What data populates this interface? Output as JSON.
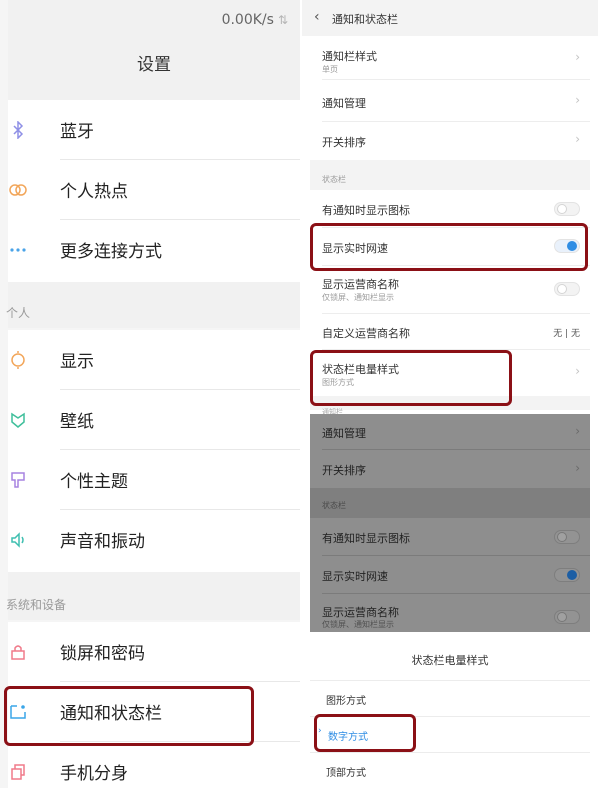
{
  "left": {
    "status_speed": "0.00K/s",
    "title": "设置",
    "connect_items": [
      {
        "label": "蓝牙",
        "icon": "bluetooth-icon"
      },
      {
        "label": "个人热点",
        "icon": "hotspot-icon"
      },
      {
        "label": "更多连接方式",
        "icon": "more-icon"
      }
    ],
    "section_personal": "个人",
    "personal_items": [
      {
        "label": "显示",
        "icon": "display-icon"
      },
      {
        "label": "壁纸",
        "icon": "wallpaper-icon"
      },
      {
        "label": "个性主题",
        "icon": "theme-icon"
      },
      {
        "label": "声音和振动",
        "icon": "sound-icon"
      }
    ],
    "section_system": "系统和设备",
    "system_items": [
      {
        "label": "锁屏和密码",
        "icon": "lock-icon"
      },
      {
        "label": "通知和状态栏",
        "icon": "notification-icon"
      },
      {
        "label": "手机分身",
        "icon": "clone-icon"
      }
    ]
  },
  "right": {
    "title": "通知和状态栏",
    "items": {
      "style": {
        "label": "通知栏样式",
        "sub": "单页"
      },
      "manage": {
        "label": "通知管理"
      },
      "order": {
        "label": "开关排序"
      }
    },
    "section_status": "状态栏",
    "toggles": {
      "show_icon": {
        "label": "有通知时显示图标",
        "on": false
      },
      "net_speed": {
        "label": "显示实时网速",
        "on": true
      },
      "carrier": {
        "label": "显示运营商名称",
        "sub": "仅锁屏、通知栏显示",
        "on": false
      }
    },
    "custom_carrier": {
      "label": "自定义运营商名称",
      "value": "无 | 无"
    },
    "battery_style": {
      "label": "状态栏电量样式",
      "sub": "图形方式"
    },
    "overlay": {
      "partial_header": "通知栏",
      "manage": "通知管理",
      "order": "开关排序",
      "section_status": "状态栏",
      "show_icon": "有通知时显示图标",
      "net_speed": "显示实时网速",
      "carrier": "显示运营商名称",
      "carrier_sub": "仅锁屏、通知栏显示"
    },
    "sheet": {
      "title": "状态栏电量样式",
      "options": [
        {
          "label": "图形方式",
          "selected": false
        },
        {
          "label": "数字方式",
          "selected": true
        },
        {
          "label": "顶部方式",
          "selected": false
        }
      ]
    }
  },
  "colors": {
    "accent": "#2f8de4",
    "annotation": "#8b1016"
  }
}
